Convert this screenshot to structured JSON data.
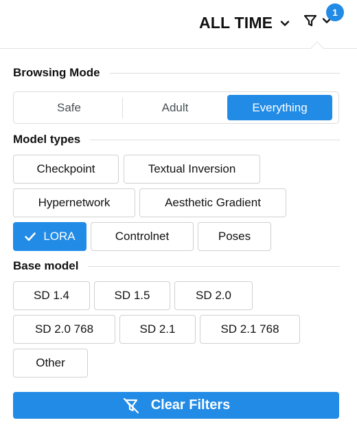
{
  "header": {
    "period_label": "ALL TIME",
    "filter_badge_count": "1"
  },
  "browsing_mode": {
    "title": "Browsing Mode",
    "options": [
      "Safe",
      "Adult",
      "Everything"
    ],
    "selected": "Everything"
  },
  "model_types": {
    "title": "Model types",
    "options": [
      "Checkpoint",
      "Textual Inversion",
      "Hypernetwork",
      "Aesthetic Gradient",
      "LORA",
      "Controlnet",
      "Poses"
    ],
    "selected": [
      "LORA"
    ]
  },
  "base_model": {
    "title": "Base model",
    "options": [
      "SD 1.4",
      "SD 1.5",
      "SD 2.0",
      "SD 2.0 768",
      "SD 2.1",
      "SD 2.1 768",
      "Other"
    ]
  },
  "clear_filters_label": "Clear Filters",
  "colors": {
    "accent": "#228be6",
    "border": "#d0d0d0",
    "divider": "#dedede"
  }
}
